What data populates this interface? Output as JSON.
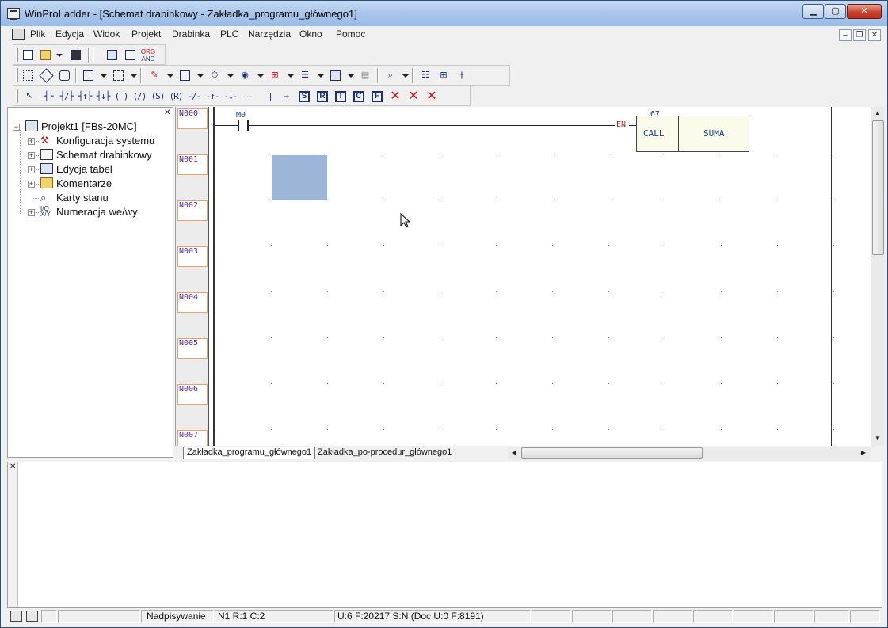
{
  "window": {
    "title": "WinProLadder - [Schemat drabinkowy - Zakładka_programu_głównego1]",
    "caption_buttons": {
      "minimize": "▁",
      "maximize": "▢",
      "close": "✕"
    }
  },
  "menubar": {
    "items": [
      "Plik",
      "Edycja",
      "Widok",
      "Projekt",
      "Drabinka",
      "PLC",
      "Narzędzia",
      "Okno",
      "Pomoc"
    ],
    "mdi_buttons": {
      "minimize": "–",
      "restore": "❐",
      "close": "✕"
    }
  },
  "toolbar_file": {
    "icons": [
      "new-file-icon",
      "open-folder-icon",
      "save-icon",
      "project-info-icon",
      "ladder-view-icon",
      "org-and-icon"
    ],
    "org_and_label_1": "ORG",
    "org_and_label_2": "AND"
  },
  "toolbar_tools": {
    "icons": [
      "run-plc-icon",
      "stop-plc-icon",
      "monitor-icon",
      "io-config-icon",
      "register-icon",
      "edit-comment-icon",
      "table-icon",
      "timer-icon",
      "counter-icon",
      "set-reset-icon",
      "list-icon",
      "data-icon",
      "calendar-icon",
      "zoom-icon",
      "layout-icon",
      "network-icon",
      "contact-help-icon"
    ]
  },
  "toolbar_ladder": {
    "items": [
      {
        "icon": "select-arrow-icon",
        "glyph": "↖"
      },
      {
        "icon": "contact-a-icon",
        "glyph": "┤├"
      },
      {
        "icon": "contact-b-icon",
        "glyph": "┤/├"
      },
      {
        "icon": "contact-up-icon",
        "glyph": "┤↑├"
      },
      {
        "icon": "contact-down-icon",
        "glyph": "┤↓├"
      },
      {
        "icon": "coil-icon",
        "glyph": "( )"
      },
      {
        "icon": "coil-negated-icon",
        "glyph": "(/)"
      },
      {
        "icon": "coil-set-icon",
        "glyph": "(S)"
      },
      {
        "icon": "coil-reset-icon",
        "glyph": "(R)"
      },
      {
        "icon": "invert-icon",
        "glyph": "-/-"
      },
      {
        "icon": "pulse-up-icon",
        "glyph": "-↑-"
      },
      {
        "icon": "pulse-down-icon",
        "glyph": "-↓-"
      },
      {
        "icon": "horizontal-line-icon",
        "glyph": "—"
      },
      {
        "icon": "vertical-line-icon",
        "glyph": "|"
      },
      {
        "icon": "arrow-right-icon",
        "glyph": "→"
      },
      {
        "icon": "s-block-icon",
        "glyph": "S"
      },
      {
        "icon": "r-block-icon",
        "glyph": "R"
      },
      {
        "icon": "t-block-icon",
        "glyph": "T"
      },
      {
        "icon": "c-block-icon",
        "glyph": "C"
      },
      {
        "icon": "f-block-icon",
        "glyph": "F"
      },
      {
        "icon": "delete-icon",
        "glyph": "✕"
      },
      {
        "icon": "delete-row-icon",
        "glyph": "✕"
      },
      {
        "icon": "delete-column-icon",
        "glyph": "✕"
      }
    ]
  },
  "project_tree": {
    "root": "Projekt1 [FBs-20MC]",
    "items": [
      {
        "label": "Konfiguracja systemu",
        "icon": "config-icon",
        "expandable": true
      },
      {
        "label": "Schemat drabinkowy",
        "icon": "ladder-diagram-icon",
        "expandable": true
      },
      {
        "label": "Edycja tabel",
        "icon": "table-edit-icon",
        "expandable": true
      },
      {
        "label": "Komentarze",
        "icon": "comments-icon",
        "expandable": true
      },
      {
        "label": "Karty stanu",
        "icon": "status-page-icon",
        "expandable": false
      },
      {
        "label": "Numeracja we/wy",
        "icon": "io-numbering-icon",
        "expandable": true
      }
    ]
  },
  "ladder": {
    "networks": [
      "N000",
      "N001",
      "N002",
      "N003",
      "N004",
      "N005",
      "N006",
      "N007"
    ],
    "rung0": {
      "contact": "M0",
      "enable_label": "EN",
      "function_number": "67",
      "function_call": "CALL",
      "function_name": "SUMA"
    }
  },
  "sheet_tabs": [
    "Zakładka_programu_głównego1",
    "Zakładka_po-procedur_głównego1"
  ],
  "scrollbars": {
    "up": "▲",
    "down": "▼",
    "left": "◀",
    "right": "▶"
  },
  "statusbar": {
    "mode": "Nadpisywanie",
    "position": "N1 R:1 C:2",
    "memory": "U:6 F:20217 S:N (Doc U:0 F:8191)"
  }
}
